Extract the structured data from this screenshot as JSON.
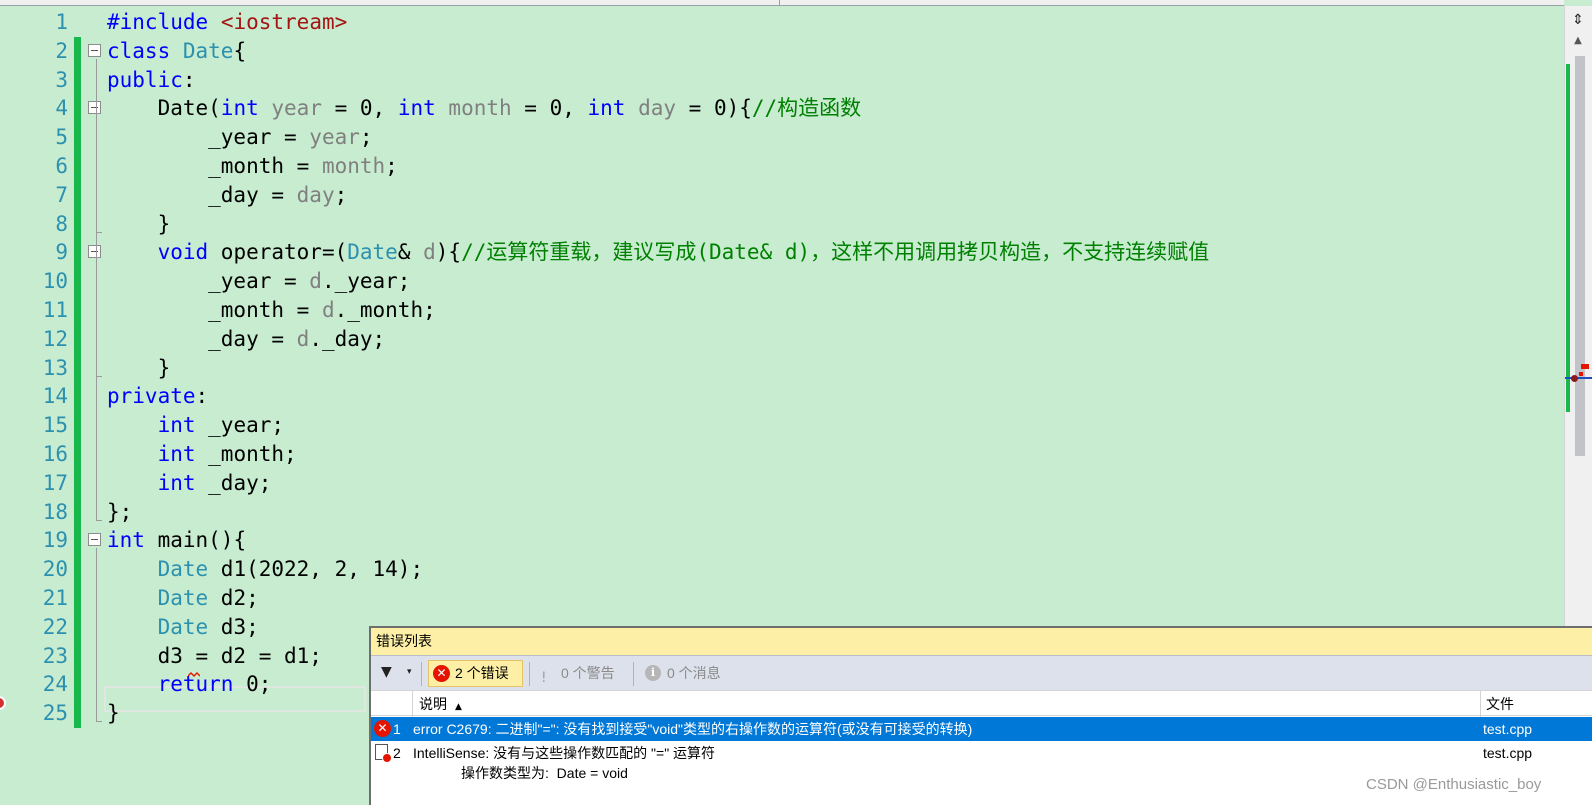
{
  "editor": {
    "lines": [
      {
        "n": "1",
        "html": "<span class=\"k\">#include</span> <span class=\"s\">&lt;iostream&gt;</span>"
      },
      {
        "n": "2",
        "html": "<span class=\"k\">class</span> <span class=\"t\">Date</span>{"
      },
      {
        "n": "3",
        "html": "<span class=\"k\">public</span>:"
      },
      {
        "n": "4",
        "html": "    Date(<span class=\"k\">int</span> <span class=\"p\">year</span> = 0, <span class=\"k\">int</span> <span class=\"p\">month</span> = 0, <span class=\"k\">int</span> <span class=\"p\">day</span> = 0){<span class=\"c\">//构造函数</span>"
      },
      {
        "n": "5",
        "html": "        _year = <span class=\"p\">year</span>;"
      },
      {
        "n": "6",
        "html": "        _month = <span class=\"p\">month</span>;"
      },
      {
        "n": "7",
        "html": "        _day = <span class=\"p\">day</span>;"
      },
      {
        "n": "8",
        "html": "    }"
      },
      {
        "n": "9",
        "html": "    <span class=\"k\">void</span> operator=(<span class=\"t\">Date</span>&amp; <span class=\"p\">d</span>){<span class=\"c\">//运算符重载，建议写成(Date&amp; d)，这样不用调用拷贝构造，不支持连续赋值</span>"
      },
      {
        "n": "10",
        "html": "        _year = <span class=\"p\">d</span>._year;"
      },
      {
        "n": "11",
        "html": "        _month = <span class=\"p\">d</span>._month;"
      },
      {
        "n": "12",
        "html": "        _day = <span class=\"p\">d</span>._day;"
      },
      {
        "n": "13",
        "html": "    }"
      },
      {
        "n": "14",
        "html": "<span class=\"k\">private</span>:"
      },
      {
        "n": "15",
        "html": "    <span class=\"k\">int</span> _year;"
      },
      {
        "n": "16",
        "html": "    <span class=\"k\">int</span> _month;"
      },
      {
        "n": "17",
        "html": "    <span class=\"k\">int</span> _day;"
      },
      {
        "n": "18",
        "html": "};"
      },
      {
        "n": "19",
        "html": "<span class=\"k\">int</span> main(){"
      },
      {
        "n": "20",
        "html": "    <span class=\"t\">Date</span> d1(2022, 2, 14);"
      },
      {
        "n": "21",
        "html": "    <span class=\"t\">Date</span> d2;"
      },
      {
        "n": "22",
        "html": "    <span class=\"t\">Date</span> d3;"
      },
      {
        "n": "23",
        "html": "    d3 = d2 = d1;"
      },
      {
        "n": "24",
        "html": "    <span class=\"k\">return</span> 0;"
      },
      {
        "n": "25",
        "html": "}"
      }
    ],
    "folds": [
      "2",
      "4",
      "9",
      "19"
    ],
    "changed_lines": [
      "2",
      "3",
      "4",
      "5",
      "6",
      "7",
      "8",
      "9",
      "10",
      "11",
      "12",
      "13",
      "14",
      "15",
      "16",
      "17",
      "18",
      "19",
      "20",
      "21",
      "22",
      "23",
      "24",
      "25"
    ]
  },
  "error_list": {
    "title": "错误列表",
    "filter_errors": "2 个错误",
    "filter_warnings": "0 个警告",
    "filter_messages": "0 个消息",
    "col_description": "说明",
    "col_file": "文件",
    "rows": [
      {
        "num": "1",
        "description": "error C2679: 二进制\"=\": 没有找到接受\"void\"类型的右操作数的运算符(或没有可接受的转换)",
        "description2": "",
        "file": "test.cpp",
        "selected": true
      },
      {
        "num": "2",
        "description": "IntelliSense: 没有与这些操作数匹配的 \"=\" 运算符",
        "description2": "操作数类型为:  Date = void",
        "file": "test.cpp",
        "selected": false
      }
    ]
  },
  "watermark": "CSDN @Enthusiastic_boy",
  "colors": {
    "editor_bg": "#c7ecd0",
    "keyword": "#0000ff",
    "type": "#2b91af",
    "comment": "#008000",
    "string": "#a31515",
    "param": "#808080",
    "change_bar": "#19b84a",
    "selection": "#0078d7",
    "error": "#e51400"
  }
}
